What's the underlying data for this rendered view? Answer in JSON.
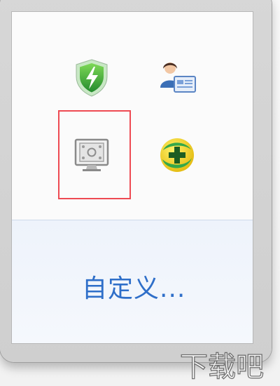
{
  "popup": {
    "icons": [
      {
        "name": "360-safe-guard-icon"
      },
      {
        "name": "user-card-icon"
      },
      {
        "name": "screen-capture-icon"
      },
      {
        "name": "360-plus-icon"
      }
    ],
    "selected_icon": "screen-capture-icon",
    "highlight_color": "#ee4a52",
    "custom_label": "自定义..."
  },
  "colors": {
    "link": "#2f6fc9",
    "bottom_bg": "#eef3fb"
  }
}
